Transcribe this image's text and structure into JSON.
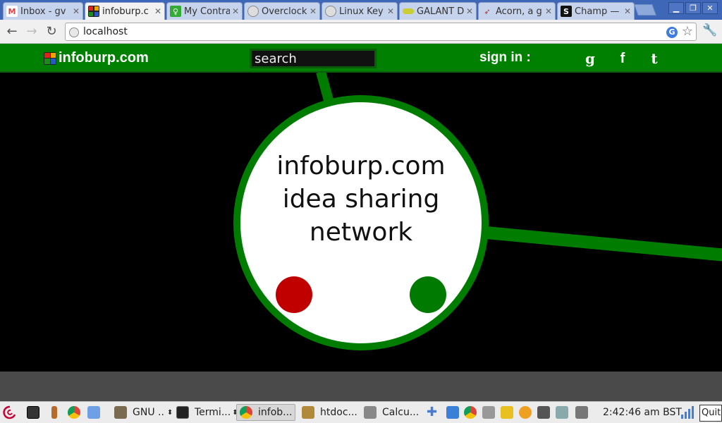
{
  "browser": {
    "tabs": [
      {
        "title": "Inbox - gv",
        "favicon": "gmail-icon",
        "color": "#d44"
      },
      {
        "title": "infoburp.c",
        "favicon": "infoburp-icon",
        "color": "#008000"
      },
      {
        "title": "My Contra",
        "favicon": "contract-icon",
        "color": "#3a3"
      },
      {
        "title": "Overclock",
        "favicon": "globe-icon",
        "color": "#999"
      },
      {
        "title": "Linux Key",
        "favicon": "globe-icon",
        "color": "#999"
      },
      {
        "title": "GALANT D",
        "favicon": "galant-icon",
        "color": "#cc3"
      },
      {
        "title": "Acorn, a g",
        "favicon": "acorn-icon",
        "color": "#fff"
      },
      {
        "title": "Champ —",
        "favicon": "champ-icon",
        "color": "#111"
      }
    ],
    "url": "localhost"
  },
  "site": {
    "logo_text": "infoburp.com",
    "logo_colors": [
      "#e0241b",
      "#f0a500",
      "#1a8c1a",
      "#2a56c6"
    ],
    "search_placeholder": "search",
    "signin_label": "sign in :",
    "social": [
      "g",
      "f",
      "t"
    ],
    "hub": {
      "title_lines": [
        "infoburp.com",
        "idea sharing",
        "network"
      ],
      "red_dot": "#c00000",
      "green_dot": "#007a00"
    },
    "colors": {
      "header": "#008000",
      "ring": "#007d00",
      "background": "#000000"
    }
  },
  "taskbar": {
    "tasks": [
      {
        "label": "GNU ..",
        "icon": "gimp-icon"
      },
      {
        "label": "Termi...",
        "icon": "terminal-icon"
      },
      {
        "label": "infob...",
        "icon": "chrome-icon",
        "active": true
      },
      {
        "label": "htdoc...",
        "icon": "folder-icon"
      },
      {
        "label": "Calcu...",
        "icon": "calculator-icon"
      }
    ],
    "clock": "2:42:46 am BST",
    "quit_label": "Quit"
  }
}
